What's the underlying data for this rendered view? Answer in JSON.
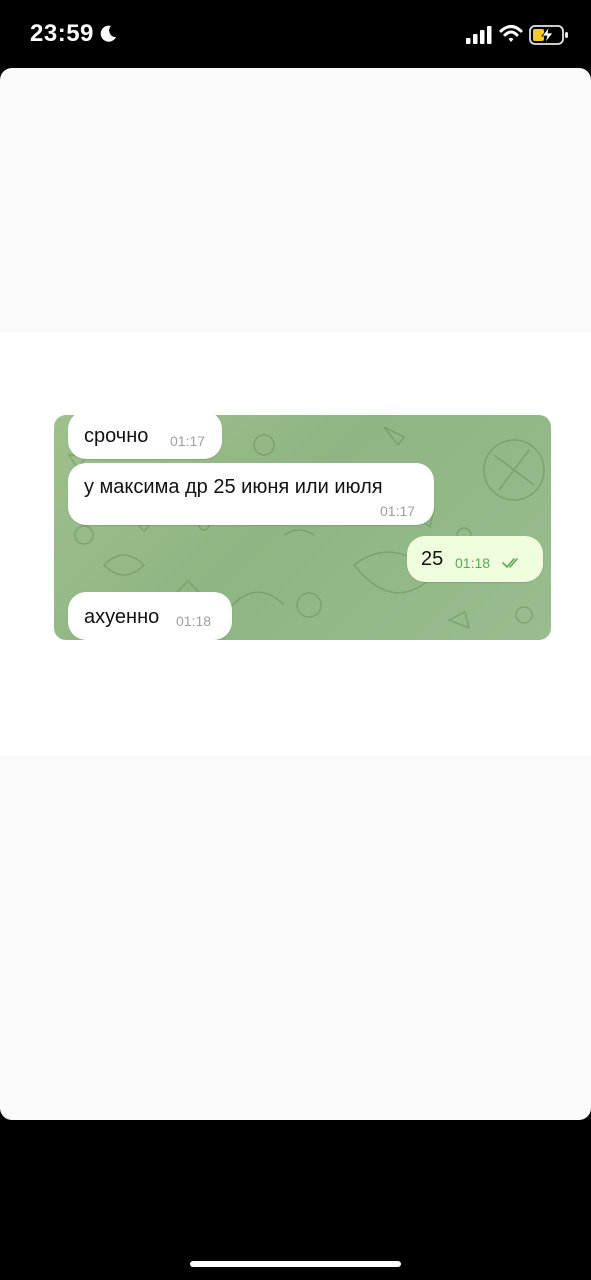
{
  "status_bar": {
    "time": "23:59",
    "icons": [
      "moon-icon",
      "cellular-signal-icon",
      "wifi-icon",
      "battery-charging-icon"
    ]
  },
  "chat": {
    "messages": [
      {
        "direction": "incoming",
        "text": "срочно",
        "time": "01:17"
      },
      {
        "direction": "incoming",
        "text": "у максима др 25 июня или июля",
        "time": "01:17"
      },
      {
        "direction": "outgoing",
        "text": "25",
        "time": "01:18",
        "status": "read"
      },
      {
        "direction": "incoming",
        "text": "ахуенно",
        "time": "01:18"
      }
    ]
  },
  "colors": {
    "chat_background": "#92b888",
    "incoming_bubble": "#ffffff",
    "outgoing_bubble": "#effedd",
    "outgoing_meta": "#5ba756"
  }
}
